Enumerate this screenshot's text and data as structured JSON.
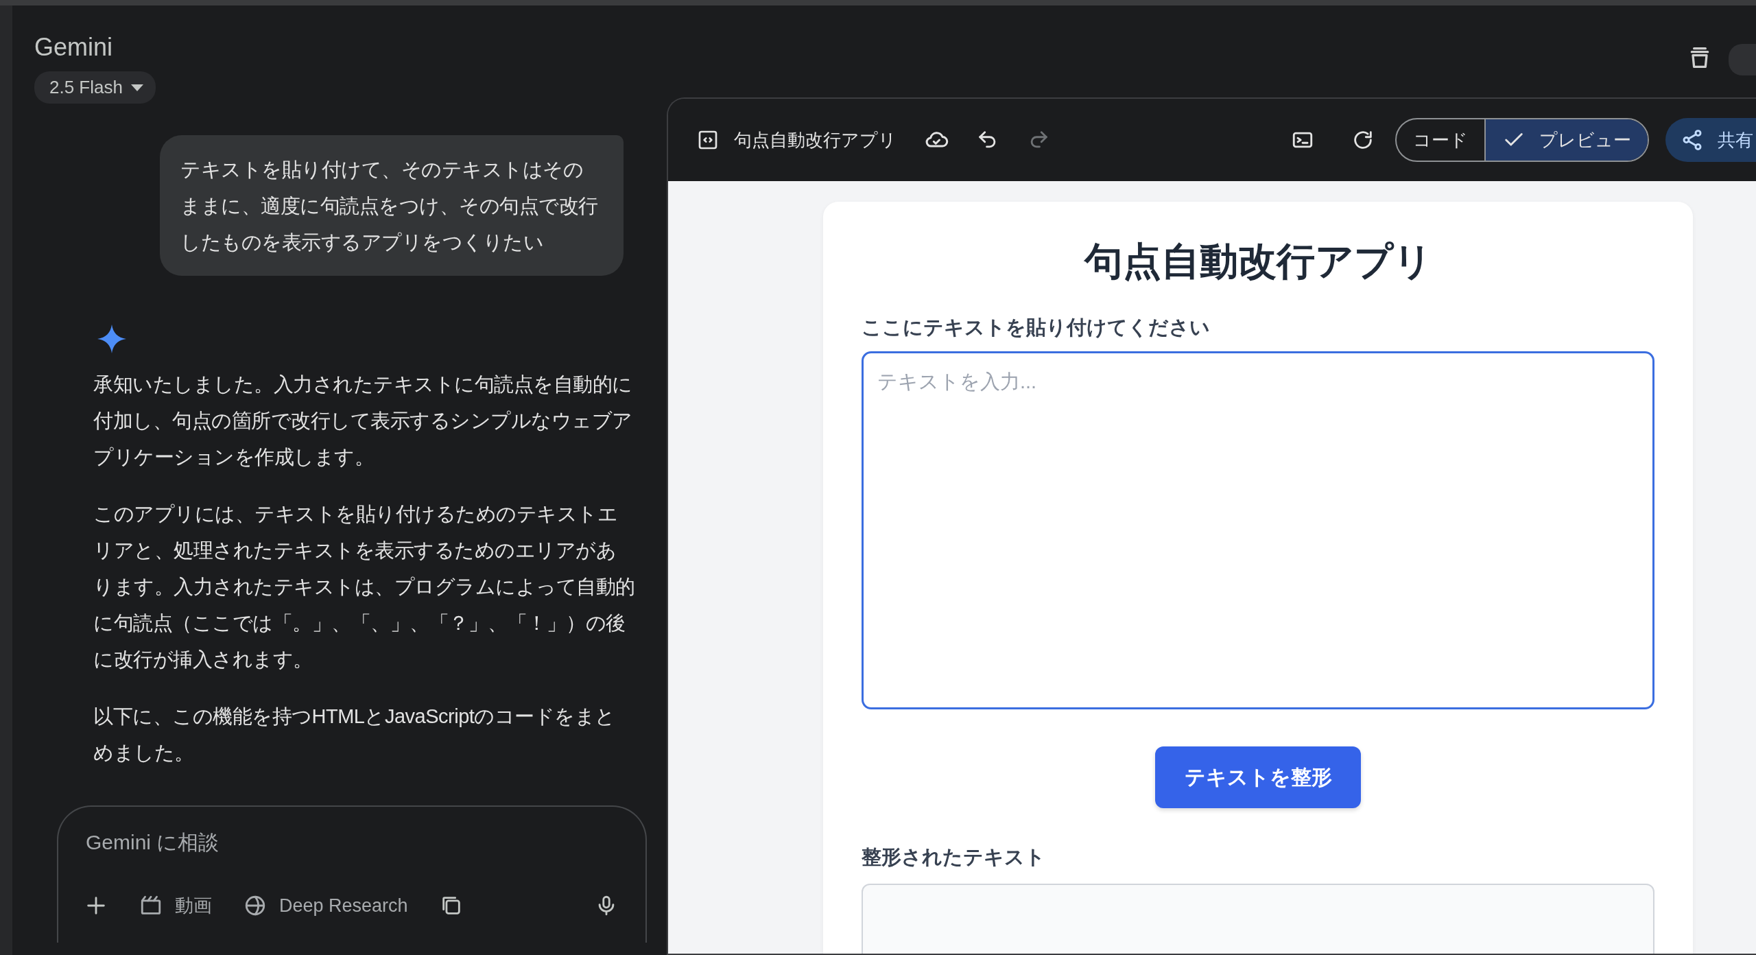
{
  "app": {
    "title": "Gemini",
    "model": "2.5 Flash"
  },
  "chat": {
    "user_message": "テキストを貼り付けて、そのテキストはそのままに、適度に句読点をつけ、その句点で改行したものを表示するアプリをつくりたい",
    "response_paragraphs": [
      "承知いたしました。入力されたテキストに句読点を自動的に付加し、句点の箇所で改行して表示するシンプルなウェブアプリケーションを作成します。",
      "このアプリには、テキストを貼り付けるためのテキストエリアと、処理されたテキストを表示するためのエリアがあります。入力されたテキストは、プログラムによって自動的に句読点（ここでは「。」、「、」、「？」、「！」）の後に改行が挿入されます。",
      "以下に、この機能を持つHTMLとJavaScriptのコードをまとめました。"
    ]
  },
  "composer": {
    "placeholder": "Gemini に相談",
    "tools": [
      {
        "kind": "video",
        "label": "動画"
      },
      {
        "kind": "research",
        "label": "Deep Research"
      }
    ]
  },
  "canvas": {
    "title": "句点自動改行アプリ",
    "view_toggle": [
      {
        "label": "コード",
        "selected": false
      },
      {
        "label": "プレビュー",
        "selected": true
      }
    ],
    "share_label": "共有"
  },
  "preview": {
    "heading": "句点自動改行アプリ",
    "input_label": "ここにテキストを貼り付けてください",
    "input_placeholder": "テキストを入力...",
    "button": "テキストを整形",
    "output_label": "整形されたテキスト"
  }
}
